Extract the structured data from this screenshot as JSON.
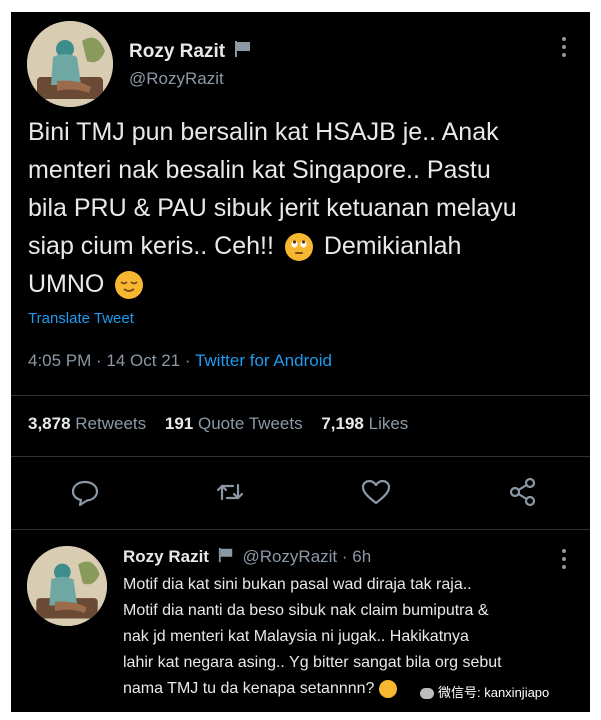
{
  "tweet": {
    "name": "Rozy Razit",
    "handle": "@RozyRazit",
    "text_lines": [
      "Bini TMJ pun bersalin kat HSAJB je.. Anak",
      "menteri nak besalin kat Singapore.. Pastu",
      "bila PRU & PAU sibuk jerit ketuanan melayu",
      "siap cium keris.. Ceh!!",
      "Demikianlah",
      "UMNO"
    ],
    "translate": "Translate Tweet",
    "time": "4:05 PM · 14 Oct 21 · ",
    "source": "Twitter for Android",
    "retweets_count": "3,878",
    "retweets_label": "Retweets",
    "quotes_count": "191",
    "quotes_label": "Quote Tweets",
    "likes_count": "7,198",
    "likes_label": "Likes"
  },
  "reply": {
    "name": "Rozy Razit",
    "handle": "@RozyRazit",
    "time": "· 6h",
    "lines": [
      "Motif dia kat sini bukan pasal wad diraja tak raja..",
      "Motif dia nanti da beso sibuk nak claim bumiputra &",
      "nak jd menteri kat Malaysia ni jugak.. Hakikatnya",
      "lahir kat negara asing.. Yg bitter sangat bila org sebut",
      "nama TMJ tu da kenapa setannnn?"
    ]
  },
  "watermark": "微信号: kanxinjiapo",
  "colors": {
    "background": "#000000",
    "text": "#e7e9ea",
    "muted": "#8b98a5",
    "accent": "#1d9bf0"
  }
}
